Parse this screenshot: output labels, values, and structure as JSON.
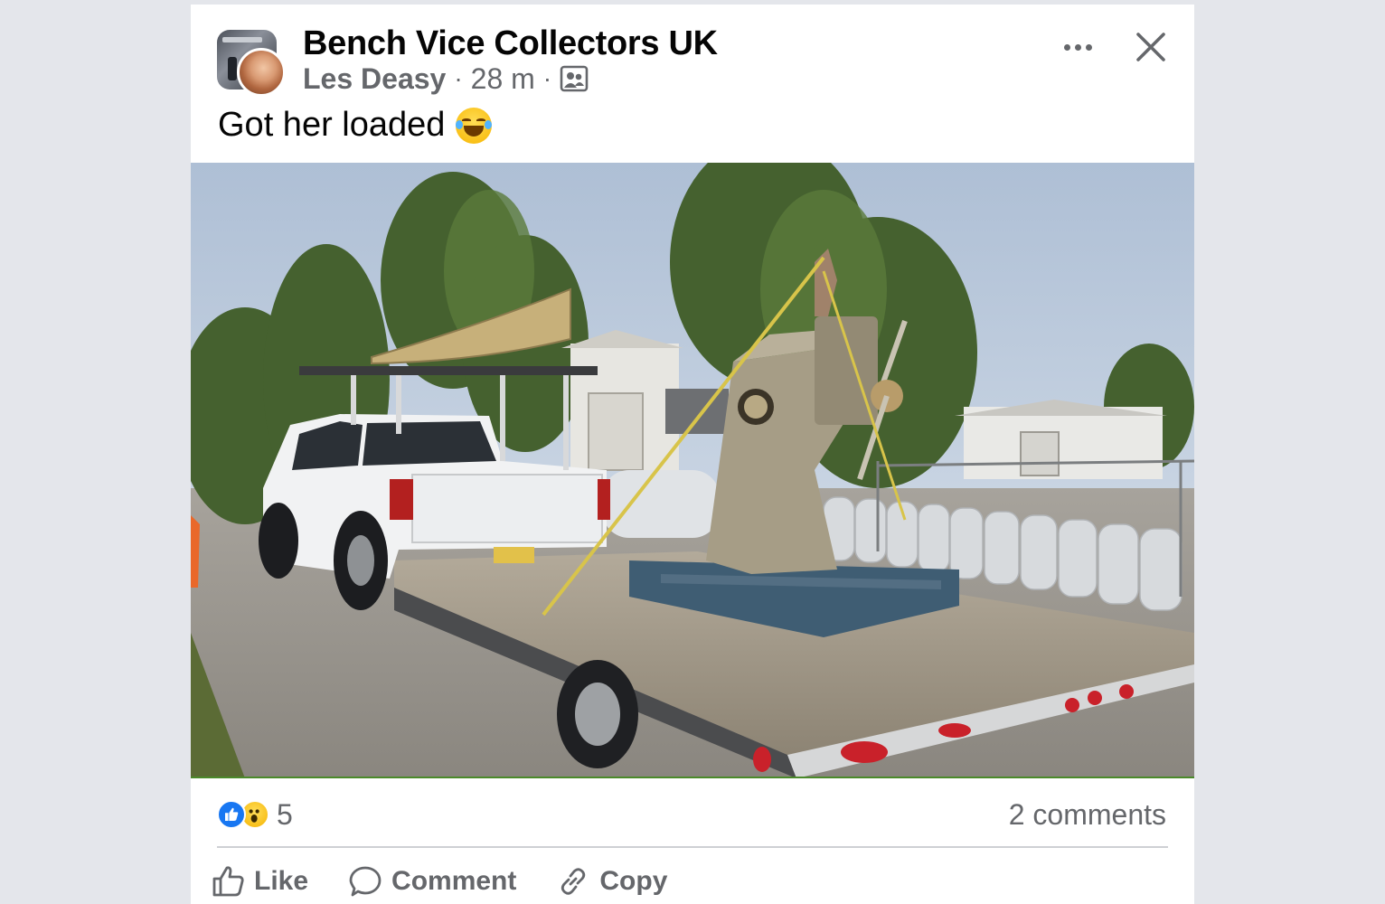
{
  "post": {
    "group_name": "Bench Vice Collectors UK",
    "author": "Les Deasy",
    "time": "28 m",
    "privacy_icon": "group-members-icon",
    "caption": "Got her loaded",
    "caption_emoji": "face-with-tears-of-joy-icon",
    "photo_icon": "post-photo",
    "reactions": [
      "like",
      "wow"
    ],
    "reaction_count": "5",
    "comments_count": "2 comments"
  },
  "actions": {
    "like": "Like",
    "comment": "Comment",
    "copy": "Copy"
  },
  "colors": {
    "background": "#e4e6eb",
    "card": "#ffffff",
    "primary_text": "#050505",
    "secondary_text": "#65676b",
    "like_blue": "#1877f2",
    "divider": "#ced0d4"
  }
}
